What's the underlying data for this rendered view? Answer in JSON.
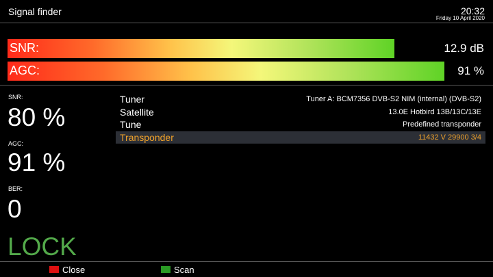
{
  "header": {
    "title": "Signal finder",
    "time": "20:32",
    "date": "Friday 10 April 2020"
  },
  "bars": [
    {
      "label": "SNR:",
      "value_text": "12.9 dB",
      "fill_fraction": 0.81
    },
    {
      "label": "AGC:",
      "value_text": "91 %",
      "fill_fraction": 0.915
    }
  ],
  "metrics": {
    "snr_label": "SNR:",
    "snr_value": "80 %",
    "agc_label": "AGC:",
    "agc_value": "91 %",
    "ber_label": "BER:",
    "ber_value": "0",
    "lock_text": "LOCK"
  },
  "info": [
    {
      "label": "Tuner",
      "value": "Tuner A: BCM7356 DVB-S2 NIM (internal) (DVB-S2)",
      "selected": false
    },
    {
      "label": "Satellite",
      "value": "13.0E Hotbird 13B/13C/13E",
      "selected": false
    },
    {
      "label": "Tune",
      "value": "Predefined transponder",
      "selected": false
    },
    {
      "label": "Transponder",
      "value": "11432 V 29900 3/4",
      "selected": true
    }
  ],
  "footer": {
    "red_label": "Close",
    "green_label": "Scan"
  },
  "colors": {
    "background": "#000000",
    "lock_green": "#53a94a",
    "selected_text": "#f0a22b",
    "selected_row_bg": "#2c2f36",
    "key_red": "#e01010",
    "key_green": "#2a9a24"
  }
}
